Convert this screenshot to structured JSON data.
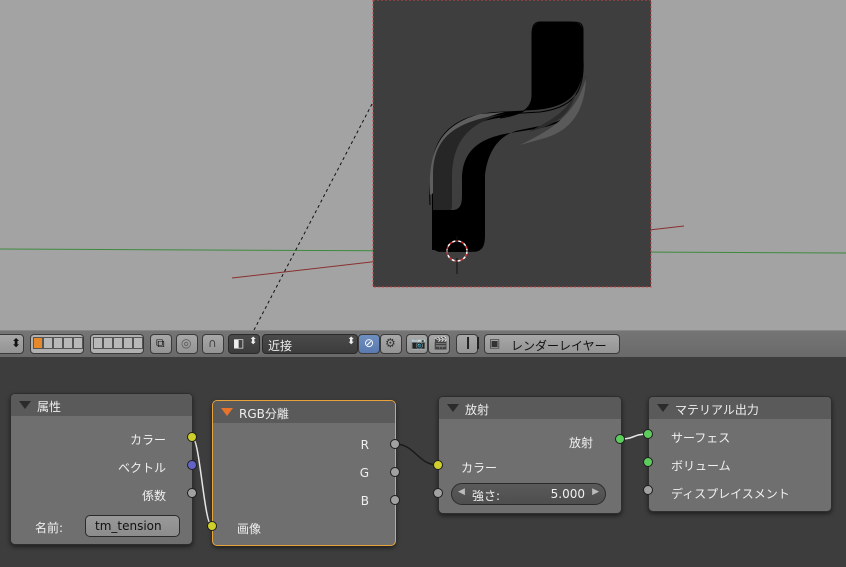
{
  "toolbar": {
    "interpolation": "近接",
    "render_layer": "レンダーレイヤー"
  },
  "nodes": {
    "attribute": {
      "title": "属性",
      "outputs": [
        "カラー",
        "ベクトル",
        "係数"
      ],
      "name_label": "名前:",
      "name_value": "tm_tension"
    },
    "separate_rgb": {
      "title": "RGB分離",
      "outputs": [
        "R",
        "G",
        "B"
      ],
      "input": "画像"
    },
    "emission": {
      "title": "放射",
      "output": "放射",
      "input_color": "カラー",
      "strength_label": "強さ:",
      "strength_value": "5.000"
    },
    "material_output": {
      "title": "マテリアル出力",
      "inputs": [
        "サーフェス",
        "ボリューム",
        "ディスプレイスメント"
      ]
    }
  },
  "colors": {
    "socket_color": "#cfcf29",
    "socket_vector": "#6363c7",
    "socket_value": "#a1a1a1",
    "socket_shader": "#5ccc5c",
    "selected_outline": "#e8a23c"
  }
}
